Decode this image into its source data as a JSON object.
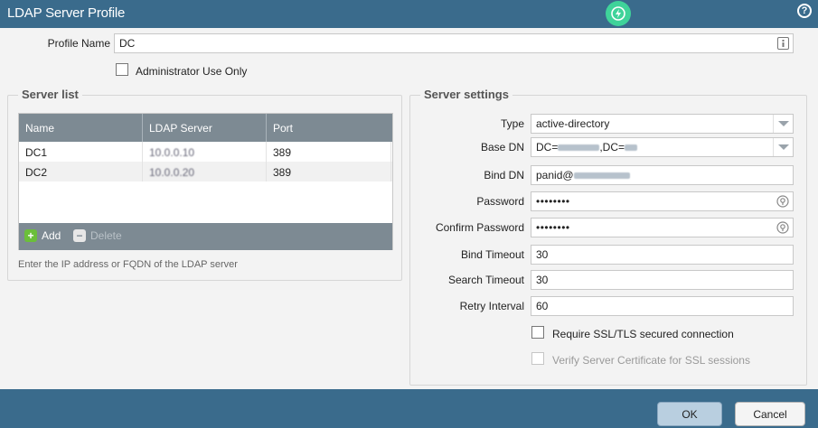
{
  "window": {
    "title": "LDAP Server Profile"
  },
  "icons": {
    "app": "bolt-icon",
    "help": "help-icon",
    "field_info": "info-icon",
    "reveal": "eye-icon"
  },
  "colors": {
    "titlebar": "#3a6b8c",
    "grid_header": "#7d8a93",
    "add_icon": "#6bbf3a",
    "app_icon": "#3fd39a"
  },
  "profile": {
    "name_label": "Profile Name",
    "name_value": "DC",
    "admin_only_label": "Administrator Use Only",
    "admin_only_checked": false
  },
  "server_list": {
    "legend": "Server list",
    "columns": [
      "Name",
      "LDAP Server",
      "Port"
    ],
    "rows": [
      {
        "name": "DC1",
        "server": "10.0.0.10",
        "port": "389"
      },
      {
        "name": "DC2",
        "server": "10.0.0.20",
        "port": "389"
      }
    ],
    "add_label": "Add",
    "delete_label": "Delete",
    "hint": "Enter the IP address or FQDN of the LDAP server"
  },
  "server_settings": {
    "legend": "Server settings",
    "type_label": "Type",
    "type_value": "active-directory",
    "base_dn_label": "Base DN",
    "base_dn_prefix": "DC=",
    "base_dn_mid": ",DC=",
    "bind_dn_label": "Bind DN",
    "bind_dn_prefix": "panid@",
    "password_label": "Password",
    "password_value": "••••••••",
    "confirm_password_label": "Confirm Password",
    "confirm_password_value": "••••••••",
    "bind_timeout_label": "Bind Timeout",
    "bind_timeout_value": "30",
    "search_timeout_label": "Search Timeout",
    "search_timeout_value": "30",
    "retry_interval_label": "Retry Interval",
    "retry_interval_value": "60",
    "require_ssl_label": "Require SSL/TLS secured connection",
    "require_ssl_checked": false,
    "verify_cert_label": "Verify Server Certificate for SSL sessions",
    "verify_cert_checked": false
  },
  "buttons": {
    "ok": "OK",
    "cancel": "Cancel"
  }
}
